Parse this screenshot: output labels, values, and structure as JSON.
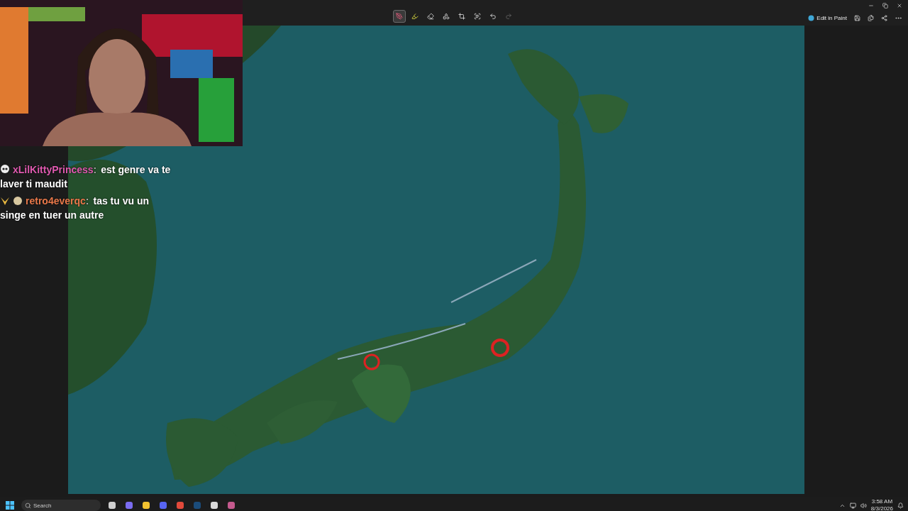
{
  "toolbar": {
    "tools": [
      {
        "kind": "pen",
        "selected": true,
        "disabled": false
      },
      {
        "kind": "highlighter",
        "selected": false,
        "disabled": false
      },
      {
        "kind": "eraser",
        "selected": false,
        "disabled": false
      },
      {
        "kind": "shapes",
        "selected": false,
        "disabled": false
      },
      {
        "kind": "crop",
        "selected": false,
        "disabled": false
      },
      {
        "kind": "text-scan",
        "selected": false,
        "disabled": false
      },
      {
        "kind": "undo",
        "selected": false,
        "disabled": false
      },
      {
        "kind": "redo",
        "selected": false,
        "disabled": true
      }
    ],
    "edit_in_paint": "Edit in Paint"
  },
  "chat": [
    {
      "kind": "skull",
      "user": "xLilKittyPrincess",
      "color": "#e05ab0",
      "separator": ":",
      "lines": [
        "est genre va te",
        "laver ti maudit"
      ]
    },
    {
      "kind": "wings-coin",
      "user": "retro4everqc",
      "color": "#e8784a",
      "separator": ":",
      "lines": [
        "tas tu vu un",
        "singe en tuer un autre"
      ]
    }
  ],
  "taskbar": {
    "search": {
      "placeholder": "Search"
    },
    "time": "3:58 AM",
    "date": "8/3/2026"
  }
}
